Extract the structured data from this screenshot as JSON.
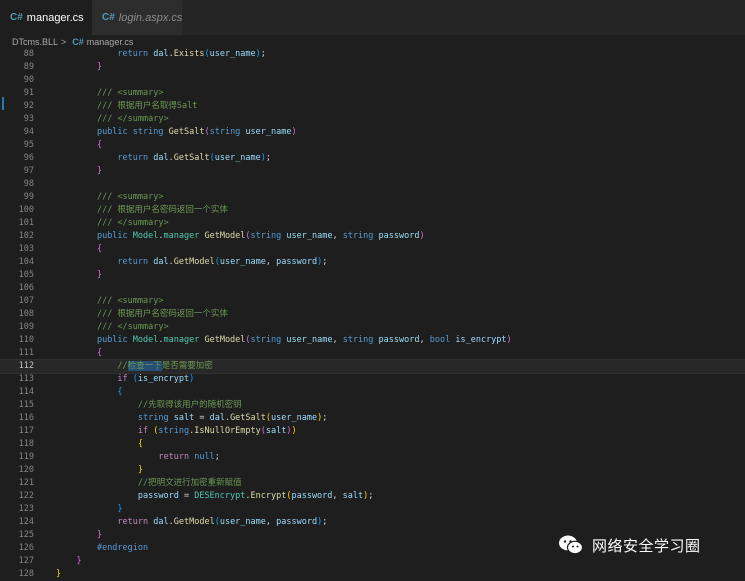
{
  "tabs": [
    {
      "icon": "C#",
      "label": "manager.cs",
      "close": "✕"
    },
    {
      "icon": "C#",
      "label": "login.aspx.cs"
    }
  ],
  "breadcrumb": {
    "project": "DTcms.BLL",
    "separator": ">",
    "icon": "C#",
    "file": "manager.cs"
  },
  "watermark": {
    "text": "网络安全学习圈"
  },
  "lines": [
    {
      "n": "88",
      "t": [
        [
          "",
          "            "
        ],
        [
          "kw",
          "return"
        ],
        [
          "",
          ""
        ],
        [
          "vr",
          " dal"
        ],
        [
          "",
          "."
        ],
        [
          "fn",
          "Exists"
        ],
        [
          "b3",
          "("
        ],
        [
          "vr",
          "user_name"
        ],
        [
          "b3",
          ")"
        ],
        [
          "",
          ";"
        ]
      ]
    },
    {
      "n": "89",
      "t": [
        [
          "",
          "        "
        ],
        [
          "b2",
          "}"
        ]
      ]
    },
    {
      "n": "90",
      "t": []
    },
    {
      "n": "91",
      "t": [
        [
          "",
          "        "
        ],
        [
          "cm",
          "/// "
        ],
        [
          "cm",
          "<summary>"
        ]
      ]
    },
    {
      "n": "92",
      "t": [
        [
          "",
          "        "
        ],
        [
          "cm",
          "/// 根据用户名取得Salt"
        ]
      ]
    },
    {
      "n": "93",
      "t": [
        [
          "",
          "        "
        ],
        [
          "cm",
          "/// "
        ],
        [
          "cm",
          "</summary>"
        ]
      ]
    },
    {
      "n": "94",
      "t": [
        [
          "",
          "        "
        ],
        [
          "kw",
          "public"
        ],
        [
          "",
          " "
        ],
        [
          "kw",
          "string"
        ],
        [
          "",
          " "
        ],
        [
          "fn",
          "GetSalt"
        ],
        [
          "b2",
          "("
        ],
        [
          "kw",
          "string"
        ],
        [
          "",
          " "
        ],
        [
          "vr",
          "user_name"
        ],
        [
          "b2",
          ")"
        ]
      ]
    },
    {
      "n": "95",
      "t": [
        [
          "",
          "        "
        ],
        [
          "b2",
          "{"
        ]
      ]
    },
    {
      "n": "96",
      "t": [
        [
          "",
          "            "
        ],
        [
          "kw",
          "return"
        ],
        [
          "",
          " "
        ],
        [
          "vr",
          "dal"
        ],
        [
          "",
          "."
        ],
        [
          "fn",
          "GetSalt"
        ],
        [
          "b3",
          "("
        ],
        [
          "vr",
          "user_name"
        ],
        [
          "b3",
          ")"
        ],
        [
          "",
          ";"
        ]
      ]
    },
    {
      "n": "97",
      "t": [
        [
          "",
          "        "
        ],
        [
          "b2",
          "}"
        ]
      ]
    },
    {
      "n": "98",
      "t": []
    },
    {
      "n": "99",
      "t": [
        [
          "",
          "        "
        ],
        [
          "cm",
          "/// "
        ],
        [
          "cm",
          "<summary>"
        ]
      ]
    },
    {
      "n": "100",
      "t": [
        [
          "",
          "        "
        ],
        [
          "cm",
          "/// 根据用户名密码返回一个实体"
        ]
      ]
    },
    {
      "n": "101",
      "t": [
        [
          "",
          "        "
        ],
        [
          "cm",
          "/// "
        ],
        [
          "cm",
          "</summary>"
        ]
      ]
    },
    {
      "n": "102",
      "t": [
        [
          "",
          "        "
        ],
        [
          "kw",
          "public"
        ],
        [
          "",
          " "
        ],
        [
          "ty",
          "Model"
        ],
        [
          "",
          "."
        ],
        [
          "ty",
          "manager"
        ],
        [
          "",
          " "
        ],
        [
          "fn",
          "GetModel"
        ],
        [
          "b2",
          "("
        ],
        [
          "kw",
          "string"
        ],
        [
          "",
          " "
        ],
        [
          "vr",
          "user_name"
        ],
        [
          "",
          ", "
        ],
        [
          "kw",
          "string"
        ],
        [
          "",
          " "
        ],
        [
          "vr",
          "password"
        ],
        [
          "b2",
          ")"
        ]
      ]
    },
    {
      "n": "103",
      "t": [
        [
          "",
          "        "
        ],
        [
          "b2",
          "{"
        ]
      ]
    },
    {
      "n": "104",
      "t": [
        [
          "",
          "            "
        ],
        [
          "kw",
          "return"
        ],
        [
          "",
          " "
        ],
        [
          "vr",
          "dal"
        ],
        [
          "",
          "."
        ],
        [
          "fn",
          "GetModel"
        ],
        [
          "b3",
          "("
        ],
        [
          "vr",
          "user_name"
        ],
        [
          "",
          ", "
        ],
        [
          "vr",
          "password"
        ],
        [
          "b3",
          ")"
        ],
        [
          "",
          ";"
        ]
      ]
    },
    {
      "n": "105",
      "t": [
        [
          "",
          "        "
        ],
        [
          "b2",
          "}"
        ]
      ]
    },
    {
      "n": "106",
      "t": []
    },
    {
      "n": "107",
      "t": [
        [
          "",
          "        "
        ],
        [
          "cm",
          "/// "
        ],
        [
          "cm",
          "<summary>"
        ]
      ]
    },
    {
      "n": "108",
      "t": [
        [
          "",
          "        "
        ],
        [
          "cm",
          "/// 根据用户名密码返回一个实体"
        ]
      ]
    },
    {
      "n": "109",
      "t": [
        [
          "",
          "        "
        ],
        [
          "cm",
          "/// "
        ],
        [
          "cm",
          "</summary>"
        ]
      ]
    },
    {
      "n": "110",
      "t": [
        [
          "",
          "        "
        ],
        [
          "kw",
          "public"
        ],
        [
          "",
          " "
        ],
        [
          "ty",
          "Model"
        ],
        [
          "",
          "."
        ],
        [
          "ty",
          "manager"
        ],
        [
          "",
          " "
        ],
        [
          "fn",
          "GetModel"
        ],
        [
          "b2",
          "("
        ],
        [
          "kw",
          "string"
        ],
        [
          "",
          " "
        ],
        [
          "vr",
          "user_name"
        ],
        [
          "",
          ", "
        ],
        [
          "kw",
          "string"
        ],
        [
          "",
          " "
        ],
        [
          "vr",
          "password"
        ],
        [
          "",
          ", "
        ],
        [
          "kw",
          "bool"
        ],
        [
          "",
          " "
        ],
        [
          "vr",
          "is_encrypt"
        ],
        [
          "b2",
          ")"
        ]
      ]
    },
    {
      "n": "111",
      "t": [
        [
          "",
          "        "
        ],
        [
          "b2",
          "{"
        ]
      ]
    },
    {
      "n": "112",
      "t": [
        [
          "",
          "            "
        ],
        [
          "cm",
          "//"
        ],
        [
          "cm sel",
          "检查一下"
        ],
        [
          "cm",
          "是否需要加密"
        ]
      ]
    },
    {
      "n": "113",
      "t": [
        [
          "",
          "            "
        ],
        [
          "ct",
          "if"
        ],
        [
          "",
          " "
        ],
        [
          "b3",
          "("
        ],
        [
          "vr",
          "is_encrypt"
        ],
        [
          "b3",
          ")"
        ]
      ]
    },
    {
      "n": "114",
      "t": [
        [
          "",
          "            "
        ],
        [
          "b3",
          "{"
        ]
      ]
    },
    {
      "n": "115",
      "t": [
        [
          "",
          "                "
        ],
        [
          "cm",
          "//先取得该用户的随机密钥"
        ]
      ]
    },
    {
      "n": "116",
      "t": [
        [
          "",
          "                "
        ],
        [
          "kw",
          "string"
        ],
        [
          "",
          " "
        ],
        [
          "vr",
          "salt"
        ],
        [
          "",
          " = "
        ],
        [
          "vr",
          "dal"
        ],
        [
          "",
          "."
        ],
        [
          "fn",
          "GetSalt"
        ],
        [
          "b1",
          "("
        ],
        [
          "vr",
          "user_name"
        ],
        [
          "b1",
          ")"
        ],
        [
          "",
          ";"
        ]
      ]
    },
    {
      "n": "117",
      "t": [
        [
          "",
          "                "
        ],
        [
          "ct",
          "if"
        ],
        [
          "",
          " "
        ],
        [
          "b1",
          "("
        ],
        [
          "kw",
          "string"
        ],
        [
          "",
          "."
        ],
        [
          "fn",
          "IsNullOrEmpty"
        ],
        [
          "b2",
          "("
        ],
        [
          "vr",
          "salt"
        ],
        [
          "b2",
          ")"
        ],
        [
          "b1",
          ")"
        ]
      ]
    },
    {
      "n": "118",
      "t": [
        [
          "",
          "                "
        ],
        [
          "b1",
          "{"
        ]
      ]
    },
    {
      "n": "119",
      "t": [
        [
          "",
          "                    "
        ],
        [
          "ct",
          "return"
        ],
        [
          "",
          " "
        ],
        [
          "kw",
          "null"
        ],
        [
          "",
          ";"
        ]
      ]
    },
    {
      "n": "120",
      "t": [
        [
          "",
          "                "
        ],
        [
          "b1",
          "}"
        ]
      ]
    },
    {
      "n": "121",
      "t": [
        [
          "",
          "                "
        ],
        [
          "cm",
          "//把明文进行加密重新赋值"
        ]
      ]
    },
    {
      "n": "122",
      "t": [
        [
          "",
          "                "
        ],
        [
          "vr",
          "password"
        ],
        [
          "",
          " = "
        ],
        [
          "ty",
          "DESEncrypt"
        ],
        [
          "",
          "."
        ],
        [
          "fn",
          "Encrypt"
        ],
        [
          "b1",
          "("
        ],
        [
          "vr",
          "password"
        ],
        [
          "",
          ", "
        ],
        [
          "vr",
          "salt"
        ],
        [
          "b1",
          ")"
        ],
        [
          "",
          ";"
        ]
      ]
    },
    {
      "n": "123",
      "t": [
        [
          "",
          "            "
        ],
        [
          "b3",
          "}"
        ]
      ]
    },
    {
      "n": "124",
      "t": [
        [
          "",
          "            "
        ],
        [
          "ct",
          "return"
        ],
        [
          "",
          " "
        ],
        [
          "vr",
          "dal"
        ],
        [
          "",
          "."
        ],
        [
          "fn",
          "GetModel"
        ],
        [
          "b3",
          "("
        ],
        [
          "vr",
          "user_name"
        ],
        [
          "",
          ", "
        ],
        [
          "vr",
          "password"
        ],
        [
          "b3",
          ")"
        ],
        [
          "",
          ";"
        ]
      ]
    },
    {
      "n": "125",
      "t": [
        [
          "",
          "        "
        ],
        [
          "b2",
          "}"
        ]
      ]
    },
    {
      "n": "126",
      "t": [
        [
          "",
          "        "
        ],
        [
          "kw",
          "#endregion"
        ]
      ]
    },
    {
      "n": "127",
      "t": [
        [
          "",
          "    "
        ],
        [
          "b2",
          "}"
        ]
      ]
    },
    {
      "n": "128",
      "t": [
        [
          "b1",
          "}"
        ]
      ]
    }
  ],
  "current_line": "112"
}
